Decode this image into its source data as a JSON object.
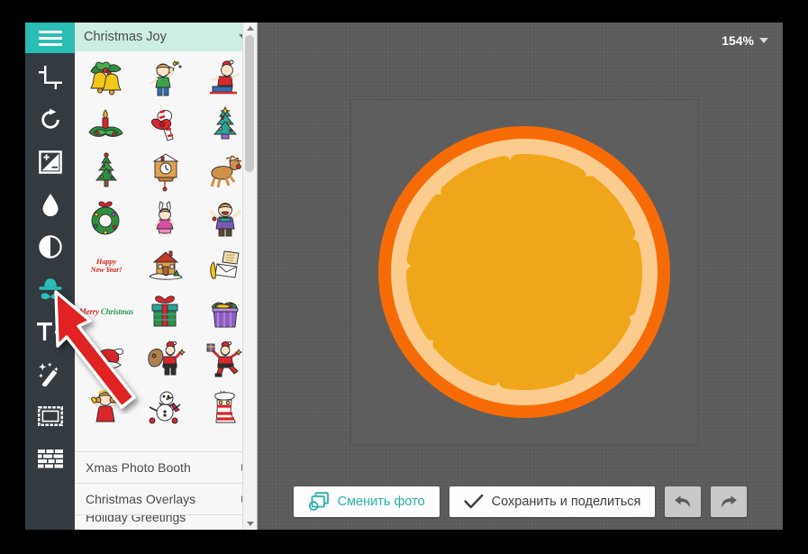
{
  "app": {
    "zoom_level": "154%",
    "accent_color": "#29bdb4",
    "toolbar_bg": "#333a40",
    "workspace_bg": "#5a5a5a",
    "panel_header_bg": "#cdeee2"
  },
  "toolbar": {
    "items": [
      {
        "name": "menu-hamburger",
        "label": "Menu",
        "active": true
      },
      {
        "name": "crop-icon",
        "label": "Crop"
      },
      {
        "name": "rotate-icon",
        "label": "Rotate"
      },
      {
        "name": "exposure-icon",
        "label": "Exposure"
      },
      {
        "name": "droplet-icon",
        "label": "Blur"
      },
      {
        "name": "contrast-icon",
        "label": "Contrast"
      },
      {
        "name": "stickers-hat-mustache-icon",
        "label": "Stickers",
        "active": true
      },
      {
        "name": "text-add-icon",
        "label": "Text"
      },
      {
        "name": "magic-wand-icon",
        "label": "Effects"
      },
      {
        "name": "frame-icon",
        "label": "Frames"
      },
      {
        "name": "texture-icon",
        "label": "Textures"
      }
    ]
  },
  "panel": {
    "header_title": "Christmas Joy",
    "header_caret": "chevron-down-icon",
    "stickers": [
      {
        "name": "holly-bells-sticker",
        "kind": "bells"
      },
      {
        "name": "kid-champagne-sticker",
        "kind": "kid-champagne"
      },
      {
        "name": "kid-sledding-sticker",
        "kind": "kid-sled"
      },
      {
        "name": "candle-holly-sticker",
        "kind": "candle"
      },
      {
        "name": "candy-cane-bow-sticker",
        "kind": "candy-cane"
      },
      {
        "name": "teal-christmas-tree-sticker",
        "kind": "tree-teal"
      },
      {
        "name": "green-christmas-tree-sticker",
        "kind": "tree-green"
      },
      {
        "name": "cuckoo-clock-sticker",
        "kind": "clock"
      },
      {
        "name": "reindeer-sticker",
        "kind": "reindeer"
      },
      {
        "name": "wreath-sticker",
        "kind": "wreath"
      },
      {
        "name": "bunny-girl-sticker",
        "kind": "bunny"
      },
      {
        "name": "cheering-kid-sticker",
        "kind": "kid-cheer"
      },
      {
        "name": "happy-new-year-text-sticker",
        "kind": "text",
        "line1": "Happy",
        "line2": "New Year!",
        "color": "#d32c2c"
      },
      {
        "name": "gingerbread-house-sticker",
        "kind": "house"
      },
      {
        "name": "letter-quill-sticker",
        "kind": "letter"
      },
      {
        "name": "merry-christmas-text-sticker",
        "kind": "text2",
        "line1": "Merry",
        "line2": "Christmas",
        "color": "#d32c2c",
        "color2": "#2f9c54"
      },
      {
        "name": "gift-box-sticker",
        "kind": "gift"
      },
      {
        "name": "gift-basket-sticker",
        "kind": "basket"
      },
      {
        "name": "santa-hat-sticker",
        "kind": "santa-hat"
      },
      {
        "name": "santa-with-sack-sticker",
        "kind": "santa-sack"
      },
      {
        "name": "santa-with-gift-sticker",
        "kind": "santa-gift"
      },
      {
        "name": "angel-girl-sticker",
        "kind": "angel"
      },
      {
        "name": "snowman-sticker",
        "kind": "snowman"
      },
      {
        "name": "christmas-stocking-sticker",
        "kind": "stocking"
      }
    ],
    "categories": [
      {
        "name": "category-xmas-photo-booth",
        "label": "Xmas Photo Booth"
      },
      {
        "name": "category-christmas-overlays",
        "label": "Christmas Overlays"
      },
      {
        "name": "category-holiday-greetings",
        "label": "Holiday Greetings"
      }
    ]
  },
  "canvas": {
    "image_name": "orange-slice-image",
    "rind_color": "#f76b06",
    "pith_color": "#fbcc8e",
    "segment_color": "#f0a61a",
    "segment_count": 9
  },
  "bottom_bar": {
    "change_photo_label": "Сменить фото",
    "change_photo_icon": "photos-stack-icon",
    "save_share_label": "Сохранить и поделиться",
    "save_share_icon": "checkmark-icon",
    "undo_icon": "undo-arrow-icon",
    "redo_icon": "redo-arrow-icon"
  },
  "annotation": {
    "arrow_name": "red-pointer-arrow",
    "color": "#e02424",
    "points_to": "stickers-hat-mustache-icon"
  }
}
